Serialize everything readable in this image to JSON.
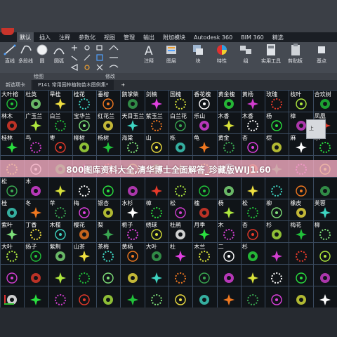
{
  "quick_access": [
    {
      "icon": "app-logo"
    },
    {
      "icon": "save-icon"
    },
    {
      "icon": "undo-icon"
    }
  ],
  "ribbon_tabs": [
    "默认",
    "插入",
    "注释",
    "参数化",
    "视图",
    "管理",
    "输出",
    "附加模块",
    "Autodesk 360",
    "BIM 360",
    "精选"
  ],
  "ribbon_active_tab": 0,
  "ribbon_tools": {
    "line": "直线",
    "polyline": "多段线",
    "circle": "圆",
    "arc": "圆弧",
    "annotation": "注释",
    "layers": "图层",
    "block": "块",
    "properties": "特性",
    "groups": "组",
    "utilities": "实用工具",
    "clipboard": "剪贴板",
    "base": "基点"
  },
  "ribbon_footer": {
    "draw": "绘图",
    "modify": "修改"
  },
  "doc_tabs": [
    {
      "label": "新选项卡",
      "active": false
    },
    {
      "label": "P141 常用园林植物苗木图例集*",
      "active": true
    },
    {
      "label": "+",
      "active": false
    }
  ],
  "canvas": {
    "background": "#101418",
    "grid_color": "#3a4a5e",
    "plant_labels_row1": [
      "园二维线图",
      "三维线图"
    ],
    "plant_labels": [
      "大叶榕",
      "杜英",
      "旱桂",
      "桂花",
      "垂榕",
      "鹅掌柴",
      "剑楠",
      "国槐",
      "香花槐",
      "黄金槐",
      "黄杨",
      "玫瑰",
      "枝叶",
      "合欢树",
      "林木",
      "广玉兰",
      "白兰",
      "宝华兰",
      "红花兰",
      "天目玉兰",
      "紫玉兰",
      "白兰花",
      "乐山",
      "木香",
      "木香",
      "杨",
      "樟",
      "凤凰",
      "桂林",
      "鸟",
      "枣",
      "柳树",
      "杨树",
      "海棠",
      "山",
      "栎",
      "龟",
      "黄金",
      "杏",
      "棕",
      "麻",
      "水",
      "松",
      "木",
      "桂",
      "冬",
      "苹",
      "梅",
      "银杏",
      "水杉",
      "樟",
      "松",
      "槐",
      "杨",
      "松",
      "柳",
      "橡皮",
      "芙蓉",
      "紫叶",
      "丁香",
      "木槿",
      "樱花",
      "梨",
      "栀子",
      "绣球",
      "杜鹃",
      "月季",
      "木",
      "杏",
      "杉",
      "梅花",
      "柳",
      "大叶",
      "扬子",
      "紫荆",
      "山茶",
      "茶梅",
      "黄杨",
      "大叶",
      "杜",
      "木兰",
      "二",
      "杉"
    ],
    "symbol_colors": [
      "#21c23a",
      "#2adf3f",
      "#3aa852",
      "#7fe07a",
      "#d23ed0",
      "#e040e0",
      "#f0e040",
      "#e63a2a",
      "#d9e23a",
      "#3ed5c2",
      "#aee83e",
      "#ffffff",
      "#f07820"
    ]
  },
  "watermark": {
    "text": "800图库资料大全,清华博士全面解答_珍藏版WIJ1.60",
    "color": "#f0aabe"
  },
  "navcube_label": "上"
}
